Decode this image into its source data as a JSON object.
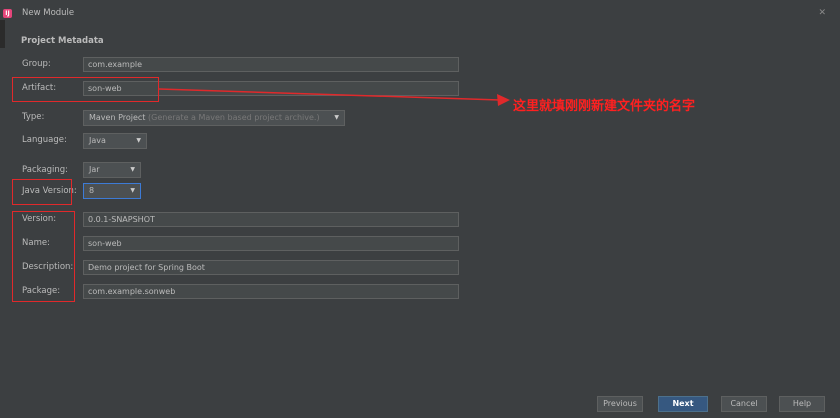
{
  "window": {
    "title": "New Module",
    "close_glyph": "✕",
    "app_icon_text": "IJ"
  },
  "section": {
    "title": "Project Metadata"
  },
  "fields": {
    "group": {
      "label": "Group:",
      "value": "com.example"
    },
    "artifact": {
      "label": "Artifact:",
      "value": "son-web"
    },
    "type": {
      "label": "Type:",
      "value": "Maven Project",
      "hint": "(Generate a Maven based project archive.)"
    },
    "language": {
      "label": "Language:",
      "value": "Java"
    },
    "packaging": {
      "label": "Packaging:",
      "value": "Jar"
    },
    "java_version": {
      "label": "Java Version:",
      "value": "8"
    },
    "version": {
      "label": "Version:",
      "value": "0.0.1-SNAPSHOT"
    },
    "name": {
      "label": "Name:",
      "value": "son-web"
    },
    "description": {
      "label": "Description:",
      "value": "Demo project for Spring Boot"
    },
    "package": {
      "label": "Package:",
      "value": "com.example.sonweb"
    }
  },
  "annotation": {
    "text": "这里就填刚刚新建文件夹的名字",
    "color": "#ff2020"
  },
  "buttons": {
    "previous": "Previous",
    "next": "Next",
    "cancel": "Cancel",
    "help": "Help"
  },
  "colors": {
    "background": "#3c3f41",
    "field_bg": "#45494a",
    "primary_button": "#365880",
    "highlight_box": "#e0292b",
    "focus_border": "#3d7bd6"
  },
  "icons": {
    "dropdown": "chevron-down-icon",
    "close": "close-icon"
  }
}
